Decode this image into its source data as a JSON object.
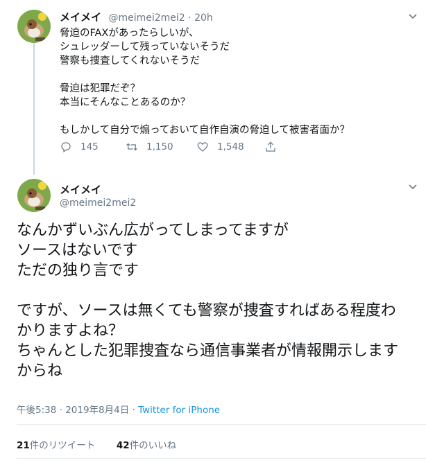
{
  "tweet1": {
    "name": "メイメイ",
    "handle": "@meimei2mei2",
    "dot": "·",
    "time": "20h",
    "lines": [
      "脅迫のFAXがあったらしいが、",
      "シュレッダーして残っていないそうだ",
      "警察も捜査してくれないそうだ",
      "",
      "脅迫は犯罪だぞ？",
      "本当にそんなことあるのか？",
      "",
      "もしかして自分で煽っておいて自作自演の脅迫して被害者面か？"
    ],
    "replies": "145",
    "retweets": "1,150",
    "likes": "1,548"
  },
  "tweet2": {
    "name": "メイメイ",
    "handle": "@meimei2mei2",
    "lines": [
      "なんかずいぶん広がってしまってますが",
      "ソースはないです",
      "ただの独り言です",
      "",
      "ですが、ソースは無くても警察が捜査すればある程度わ",
      "かりますよね？",
      "ちゃんとした犯罪捜査なら通信事業者が情報開示します",
      "からね"
    ],
    "timestamp": "午後5:38 · 2019年8月4日",
    "separator": "·",
    "client": "Twitter for iPhone",
    "retweet_count": "21",
    "retweet_label": "件のリツイート",
    "like_count": "42",
    "like_label": "件のいいね"
  },
  "icons": [
    "avatar-sparrow",
    "chevron-down-icon",
    "reply-icon",
    "retweet-icon",
    "like-icon",
    "share-icon"
  ],
  "colors": {
    "muted": "#657786",
    "link": "#1b95e0",
    "line": "#ccd6dd"
  }
}
